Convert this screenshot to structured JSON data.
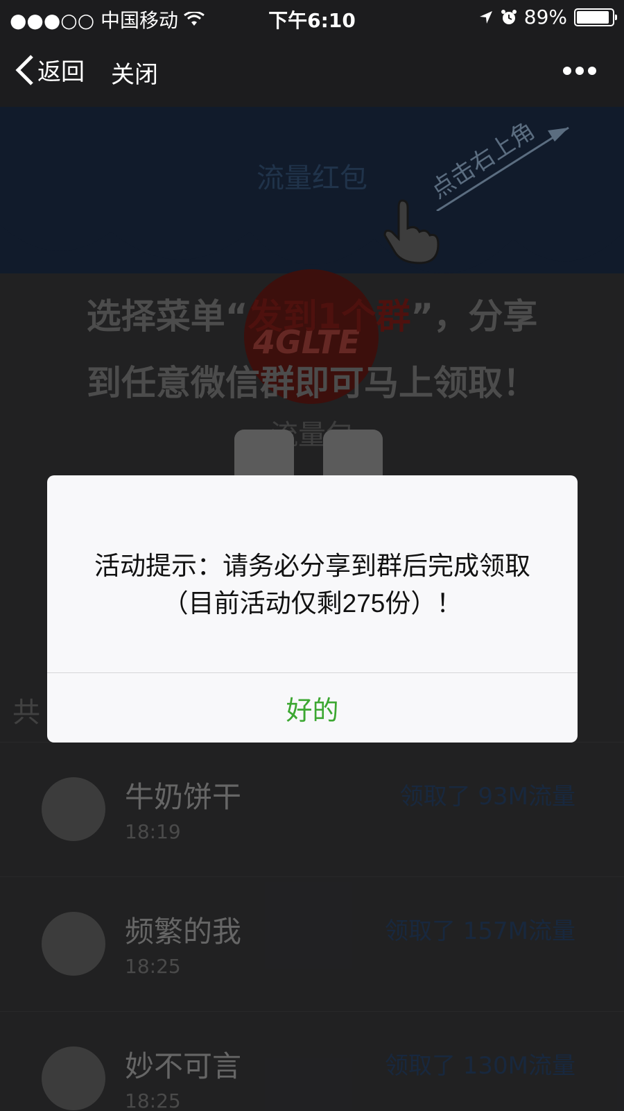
{
  "status_bar": {
    "carrier": "●●●○○ 中国移动",
    "time": "下午6:10",
    "battery": "89%"
  },
  "nav": {
    "back_label": "返回",
    "close_label": "关闭"
  },
  "page": {
    "banner_title": "流量红包",
    "corner_hint": "点击右上角",
    "logo_text": "4GLTE",
    "instruction_line1_prefix": "选择菜单“",
    "instruction_line1_highlight": "发到1个群",
    "instruction_line1_suffix": "”，分享",
    "instruction_line2": "到任意微信群即可马上领取！",
    "packet_label": "流量包",
    "list_header": "共",
    "records": [
      {
        "name": "牛奶饼干",
        "time": "18:19",
        "amount": "领取了 93M流量"
      },
      {
        "name": "频繁的我",
        "time": "18:25",
        "amount": "领取了 157M流量"
      },
      {
        "name": "妙不可言",
        "time": "18:25",
        "amount": "领取了 130M流量"
      }
    ]
  },
  "dialog": {
    "message_line1": "活动提示：请务必分享到群后完成领取",
    "message_line2": "（目前活动仅剩275份）！",
    "confirm_label": "好的"
  },
  "colors": {
    "confirm_green": "#3ca731",
    "highlight_red": "#8e1f1a",
    "nav_bg": "#1c1c1e"
  }
}
